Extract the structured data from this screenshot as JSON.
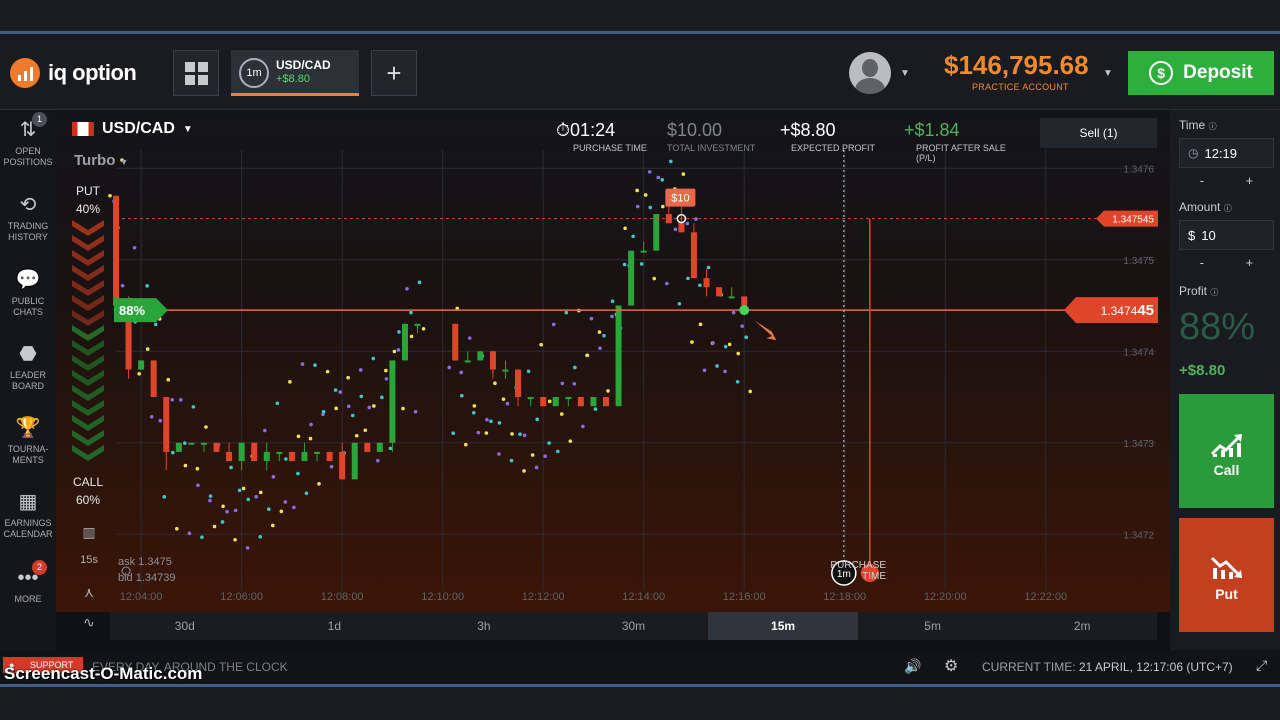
{
  "app": {
    "logo_text": "iq option",
    "asset_tab": {
      "timeframe": "1m",
      "name": "USD/CAD",
      "pnl": "+$8.80"
    },
    "balance": "$146,795.68",
    "account_type": "PRACTICE ACCOUNT",
    "deposit_label": "Deposit"
  },
  "sidebar": {
    "items": [
      {
        "label1": "OPEN",
        "label2": "POSITIONS",
        "badge": "1",
        "icon": "arrows-updown-icon"
      },
      {
        "label1": "TRADING",
        "label2": "HISTORY",
        "icon": "history-icon"
      },
      {
        "label1": "PUBLIC",
        "label2": "CHATS",
        "icon": "chat-icon"
      },
      {
        "label1": "LEADER",
        "label2": "BOARD",
        "icon": "leaderboard-icon"
      },
      {
        "label1": "TOURNA-",
        "label2": "MENTS",
        "icon": "trophy-icon"
      },
      {
        "label1": "EARNINGS",
        "label2": "CALENDAR",
        "icon": "calendar-icon"
      },
      {
        "label1": "MORE",
        "label2": "",
        "badge": "2",
        "icon": "more-icon"
      }
    ]
  },
  "chart_header": {
    "asset": "USD/CAD",
    "mode": "Turbo",
    "purchase_time": {
      "value": "01:24",
      "label": "PURCHASE TIME"
    },
    "total_investment": {
      "value": "$10.00",
      "label": "TOTAL INVESTMENT"
    },
    "expected_profit": {
      "value": "+$8.80",
      "label": "EXPECTED PROFIT"
    },
    "profit_after_sale": {
      "value": "+$1.84",
      "label": "PROFIT AFTER SALE",
      "sub": "(P/L)"
    },
    "sell_button": "Sell (1)"
  },
  "sentiment": {
    "put_label": "PUT",
    "put_pct": "40%",
    "call_label": "CALL",
    "call_pct": "60%"
  },
  "chart_info": {
    "ask": "ask 1.3475",
    "bid": "bid 1.34739",
    "period_label": "15s"
  },
  "markers": {
    "entry_tag": "$10",
    "pct_tag": "88%",
    "purchase_label1": "PURCHASE",
    "purchase_label2": "TIME",
    "expiry_circle": "1m"
  },
  "price_tags": {
    "entry": "1.347545",
    "current_main": "1.3474",
    "current_last": "45"
  },
  "chart_data": {
    "type": "candlestick",
    "x_ticks": [
      "12:04:00",
      "12:06:00",
      "12:08:00",
      "12:10:00",
      "12:12:00",
      "12:14:00",
      "12:16:00",
      "12:18:00",
      "12:20:00",
      "12:22:00"
    ],
    "y_ticks": [
      "1.3476",
      "1.3475",
      "1.3474",
      "1.3473",
      "1.3472"
    ],
    "ylim": [
      1.34715,
      1.34762
    ],
    "entry_price": 1.347545,
    "current_price": 1.347445,
    "colors": {
      "up": "#2aa53a",
      "down": "#e0452a",
      "background_top": "#0f1116",
      "background_bottom": "#3a1508"
    },
    "candles": [
      {
        "t": "12:03:30",
        "o": 1.34757,
        "h": 1.34757,
        "l": 1.34745,
        "c": 1.34745
      },
      {
        "t": "12:03:45",
        "o": 1.34745,
        "h": 1.34746,
        "l": 1.34737,
        "c": 1.34738
      },
      {
        "t": "12:04:00",
        "o": 1.34738,
        "h": 1.34739,
        "l": 1.34738,
        "c": 1.34739
      },
      {
        "t": "12:04:15",
        "o": 1.34739,
        "h": 1.34739,
        "l": 1.34735,
        "c": 1.34735
      },
      {
        "t": "12:04:30",
        "o": 1.34735,
        "h": 1.34735,
        "l": 1.34727,
        "c": 1.34729
      },
      {
        "t": "12:04:45",
        "o": 1.34729,
        "h": 1.3473,
        "l": 1.34729,
        "c": 1.3473
      },
      {
        "t": "12:05:00",
        "o": 1.3473,
        "h": 1.3473,
        "l": 1.3473,
        "c": 1.3473
      },
      {
        "t": "12:05:15",
        "o": 1.3473,
        "h": 1.3473,
        "l": 1.34729,
        "c": 1.3473
      },
      {
        "t": "12:05:30",
        "o": 1.3473,
        "h": 1.3473,
        "l": 1.34729,
        "c": 1.34729
      },
      {
        "t": "12:05:45",
        "o": 1.34729,
        "h": 1.3473,
        "l": 1.34728,
        "c": 1.34728
      },
      {
        "t": "12:06:00",
        "o": 1.34728,
        "h": 1.3473,
        "l": 1.34727,
        "c": 1.3473
      },
      {
        "t": "12:06:15",
        "o": 1.3473,
        "h": 1.3473,
        "l": 1.34728,
        "c": 1.34728
      },
      {
        "t": "12:06:30",
        "o": 1.34728,
        "h": 1.3473,
        "l": 1.34727,
        "c": 1.34729
      },
      {
        "t": "12:06:45",
        "o": 1.34729,
        "h": 1.34729,
        "l": 1.34728,
        "c": 1.34729
      },
      {
        "t": "12:07:00",
        "o": 1.34729,
        "h": 1.34729,
        "l": 1.34728,
        "c": 1.34728
      },
      {
        "t": "12:07:15",
        "o": 1.34728,
        "h": 1.3473,
        "l": 1.34728,
        "c": 1.34729
      },
      {
        "t": "12:07:30",
        "o": 1.34729,
        "h": 1.34729,
        "l": 1.34728,
        "c": 1.34729
      },
      {
        "t": "12:07:45",
        "o": 1.34729,
        "h": 1.34729,
        "l": 1.34728,
        "c": 1.34728
      },
      {
        "t": "12:08:00",
        "o": 1.34729,
        "h": 1.3473,
        "l": 1.34726,
        "c": 1.34726
      },
      {
        "t": "12:08:15",
        "o": 1.34726,
        "h": 1.3473,
        "l": 1.34726,
        "c": 1.3473
      },
      {
        "t": "12:08:30",
        "o": 1.3473,
        "h": 1.3473,
        "l": 1.34729,
        "c": 1.34729
      },
      {
        "t": "12:08:45",
        "o": 1.34729,
        "h": 1.3473,
        "l": 1.34729,
        "c": 1.3473
      },
      {
        "t": "12:09:00",
        "o": 1.3473,
        "h": 1.34739,
        "l": 1.34729,
        "c": 1.34739
      },
      {
        "t": "12:09:15",
        "o": 1.34739,
        "h": 1.34743,
        "l": 1.34739,
        "c": 1.34743
      },
      {
        "t": "12:09:30",
        "o": 1.34743,
        "h": 1.34743,
        "l": 1.34742,
        "c": 1.34743
      },
      {
        "t": "12:10:15",
        "o": 1.34743,
        "h": 1.34743,
        "l": 1.34739,
        "c": 1.34739
      },
      {
        "t": "12:10:30",
        "o": 1.34739,
        "h": 1.3474,
        "l": 1.34739,
        "c": 1.34739
      },
      {
        "t": "12:10:45",
        "o": 1.34739,
        "h": 1.3474,
        "l": 1.34739,
        "c": 1.3474
      },
      {
        "t": "12:11:00",
        "o": 1.3474,
        "h": 1.3474,
        "l": 1.34737,
        "c": 1.34738
      },
      {
        "t": "12:11:15",
        "o": 1.34738,
        "h": 1.34739,
        "l": 1.34737,
        "c": 1.34738
      },
      {
        "t": "12:11:30",
        "o": 1.34738,
        "h": 1.34738,
        "l": 1.34734,
        "c": 1.34735
      },
      {
        "t": "12:11:45",
        "o": 1.34735,
        "h": 1.34735,
        "l": 1.34734,
        "c": 1.34735
      },
      {
        "t": "12:12:00",
        "o": 1.34735,
        "h": 1.34735,
        "l": 1.34734,
        "c": 1.34734
      },
      {
        "t": "12:12:15",
        "o": 1.34734,
        "h": 1.34735,
        "l": 1.34734,
        "c": 1.34735
      },
      {
        "t": "12:12:30",
        "o": 1.34735,
        "h": 1.34735,
        "l": 1.34734,
        "c": 1.34735
      },
      {
        "t": "12:12:45",
        "o": 1.34735,
        "h": 1.34735,
        "l": 1.34734,
        "c": 1.34734
      },
      {
        "t": "12:13:00",
        "o": 1.34734,
        "h": 1.34735,
        "l": 1.34734,
        "c": 1.34735
      },
      {
        "t": "12:13:15",
        "o": 1.34735,
        "h": 1.34735,
        "l": 1.34734,
        "c": 1.34734
      },
      {
        "t": "12:13:30",
        "o": 1.34734,
        "h": 1.34745,
        "l": 1.34734,
        "c": 1.34745
      },
      {
        "t": "12:13:45",
        "o": 1.34745,
        "h": 1.34751,
        "l": 1.34745,
        "c": 1.34751
      },
      {
        "t": "12:14:00",
        "o": 1.34751,
        "h": 1.34752,
        "l": 1.34751,
        "c": 1.34751
      },
      {
        "t": "12:14:15",
        "o": 1.34751,
        "h": 1.34755,
        "l": 1.34751,
        "c": 1.34755
      },
      {
        "t": "12:14:30",
        "o": 1.34755,
        "h": 1.34756,
        "l": 1.34754,
        "c": 1.34754
      },
      {
        "t": "12:14:45",
        "o": 1.34754,
        "h": 1.34756,
        "l": 1.34753,
        "c": 1.34753
      },
      {
        "t": "12:15:00",
        "o": 1.34753,
        "h": 1.34754,
        "l": 1.34748,
        "c": 1.34748
      },
      {
        "t": "12:15:15",
        "o": 1.34748,
        "h": 1.34749,
        "l": 1.34746,
        "c": 1.34747
      },
      {
        "t": "12:15:30",
        "o": 1.34747,
        "h": 1.34747,
        "l": 1.34746,
        "c": 1.34746
      },
      {
        "t": "12:15:45",
        "o": 1.34746,
        "h": 1.34747,
        "l": 1.34746,
        "c": 1.34746
      },
      {
        "t": "12:16:00",
        "o": 1.34746,
        "h": 1.34746,
        "l": 1.34745,
        "c": 1.34745
      }
    ],
    "time_range": [
      "12:03:30",
      "12:23:00"
    ],
    "purchase_time": "12:18:30",
    "expiry_time": "12:17:06"
  },
  "right_panel": {
    "time_label": "Time",
    "time_value": "12:19",
    "amount_label": "Amount",
    "amount_currency": "$",
    "amount_value": "10",
    "profit_label": "Profit",
    "profit_pct": "88%",
    "profit_value": "+$8.80",
    "call_label": "Call",
    "put_label": "Put",
    "minus": "-",
    "plus": "+"
  },
  "timeframes": [
    "30d",
    "1d",
    "3h",
    "30m",
    "15m",
    "5m",
    "2m"
  ],
  "active_timeframe": "15m",
  "footer": {
    "support": "SUPPORT",
    "everyday": "EVERY DAY, AROUND THE CLOCK",
    "current_time_label": "CURRENT TIME:",
    "current_time_value": "21 APRIL, 12:17:06",
    "timezone": "(UTC+7)"
  },
  "watermark": "Screencast-O-Matic.com"
}
